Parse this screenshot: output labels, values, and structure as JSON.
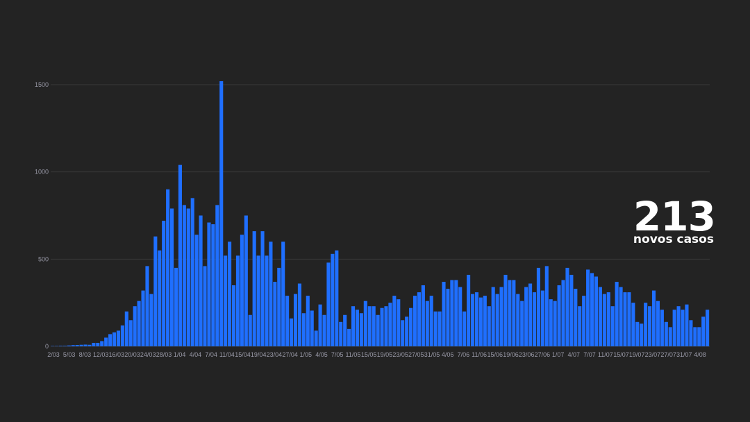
{
  "chart_data": {
    "type": "bar",
    "title": "",
    "xlabel": "",
    "ylabel": "",
    "ylim": [
      0,
      1500
    ],
    "grid": true,
    "bar_color": "#1f6fff",
    "background_color": "#232323",
    "y_ticks": [
      "0",
      "500",
      "1000",
      "1500"
    ],
    "x_tick_labels": [
      "2/03",
      "5/03",
      "8/03",
      "12/03",
      "16/03",
      "20/03",
      "24/03",
      "28/03",
      "1/04",
      "4/04",
      "7/04",
      "11/04",
      "15/04",
      "19/04",
      "23/04",
      "27/04",
      "1/05",
      "4/05",
      "7/05",
      "11/05",
      "15/05",
      "19/05",
      "23/05",
      "27/05",
      "31/05",
      "4/06",
      "7/06",
      "11/06",
      "15/06",
      "19/06",
      "23/06",
      "27/06",
      "1/07",
      "4/07",
      "7/07",
      "11/07",
      "15/07",
      "19/07",
      "23/07",
      "27/07",
      "31/07",
      "4/08"
    ],
    "values": [
      2,
      2,
      3,
      3,
      5,
      7,
      8,
      9,
      10,
      9,
      20,
      20,
      30,
      50,
      70,
      80,
      90,
      120,
      200,
      150,
      230,
      260,
      320,
      460,
      300,
      630,
      550,
      720,
      900,
      790,
      450,
      1040,
      810,
      790,
      850,
      640,
      750,
      460,
      710,
      700,
      810,
      1520,
      520,
      600,
      350,
      520,
      640,
      750,
      180,
      660,
      520,
      660,
      520,
      600,
      370,
      450,
      600,
      290,
      160,
      300,
      360,
      190,
      290,
      205,
      90,
      240,
      180,
      480,
      530,
      550,
      140,
      180,
      100,
      230,
      210,
      190,
      260,
      230,
      230,
      180,
      220,
      230,
      250,
      290,
      270,
      150,
      170,
      220,
      290,
      310,
      350,
      260,
      290,
      200,
      200,
      370,
      330,
      380,
      380,
      340,
      200,
      410,
      300,
      310,
      280,
      290,
      230,
      340,
      300,
      340,
      410,
      380,
      380,
      300,
      260,
      340,
      360,
      310,
      450,
      320,
      460,
      270,
      260,
      350,
      380,
      450,
      410,
      330,
      230,
      290,
      440,
      420,
      400,
      340,
      300,
      310,
      230,
      370,
      340,
      310,
      310,
      250,
      140,
      130,
      250,
      230,
      320,
      260,
      210,
      140,
      110,
      210,
      230,
      210,
      240,
      150,
      110,
      110,
      170,
      210
    ],
    "callout": {
      "value": "213",
      "label": "novos casos"
    }
  }
}
